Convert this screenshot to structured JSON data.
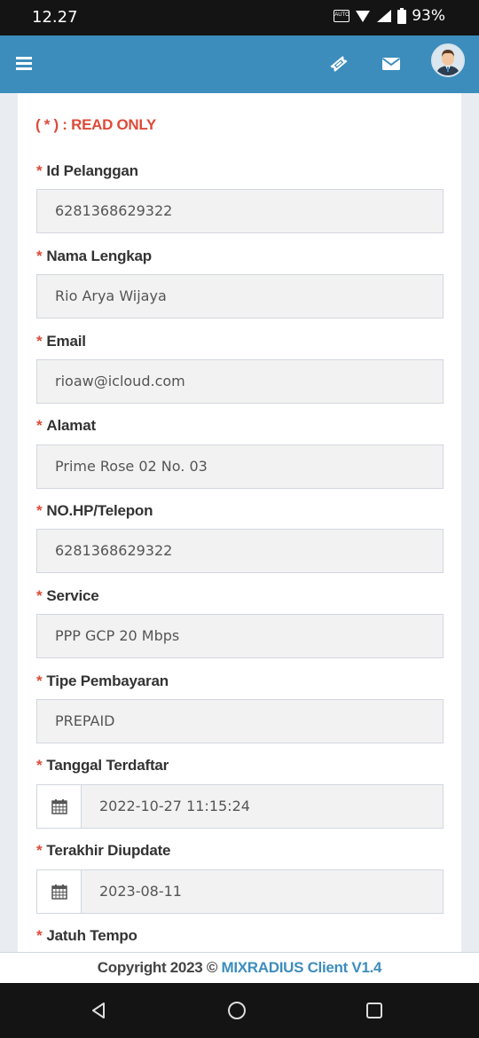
{
  "status_bar": {
    "time": "12.27",
    "battery": "93%",
    "auto_label": "AUTO"
  },
  "header": {
    "menu_icon": "hamburger-menu-icon",
    "ticket_icon": "ticket-icon",
    "mail_icon": "envelope-icon",
    "avatar_icon": "user-avatar"
  },
  "colors": {
    "header": "#3c8dbc",
    "required_star": "#dd4b39",
    "brand": "#3c8dbc"
  },
  "form": {
    "note": "( * ) : READ ONLY",
    "required_mark": "*",
    "fields": [
      {
        "label": "Id Pelanggan",
        "value": "6281368629322"
      },
      {
        "label": "Nama Lengkap",
        "value": "Rio Arya Wijaya"
      },
      {
        "label": "Email",
        "value": "rioaw@icloud.com"
      },
      {
        "label": "Alamat",
        "value": "Prime Rose 02 No. 03"
      },
      {
        "label": "NO.HP/Telepon",
        "value": "6281368629322"
      },
      {
        "label": "Service",
        "value": "PPP GCP 20 Mbps"
      },
      {
        "label": "Tipe Pembayaran",
        "value": "PREPAID"
      },
      {
        "label": "Tanggal Terdaftar",
        "value": "2022-10-27 11:15:24",
        "icon": "calendar-icon"
      },
      {
        "label": "Terakhir Diupdate",
        "value": "2023-08-11",
        "icon": "calendar-icon"
      },
      {
        "label": "Jatuh Tempo",
        "value": ""
      }
    ]
  },
  "footer": {
    "copyright": "Copyright 2023 © ",
    "brand": "MIXRADIUS Client V1.4"
  },
  "nav": {
    "back_icon": "back-triangle-icon",
    "home_icon": "home-circle-icon",
    "recents_icon": "recents-square-icon"
  }
}
